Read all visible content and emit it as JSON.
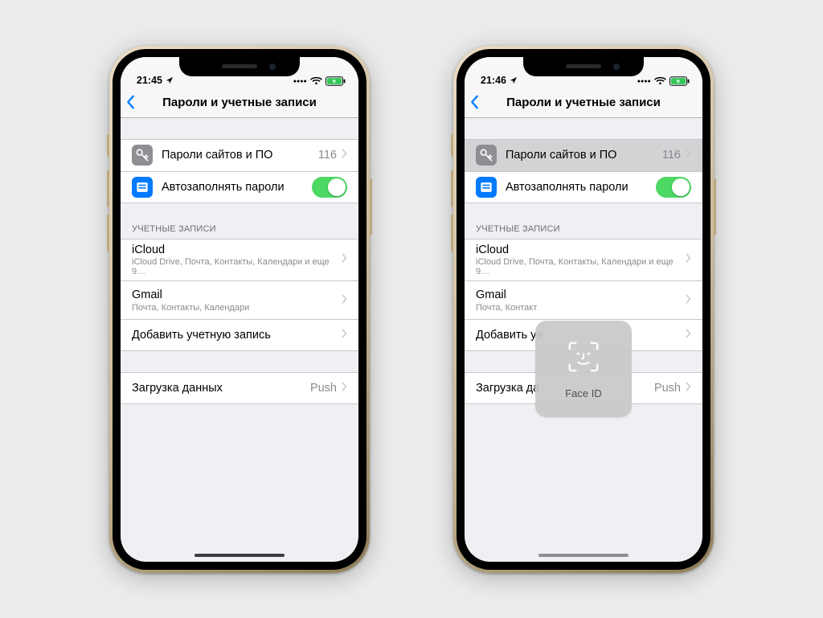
{
  "phone1": {
    "status_time": "21:45",
    "nav_title": "Пароли и учетные записи",
    "passwords_row_pressed": false
  },
  "phone2": {
    "status_time": "21:46",
    "nav_title": "Пароли и учетные записи",
    "passwords_row_pressed": true,
    "faceid_label": "Face ID"
  },
  "shared": {
    "passwords_label": "Пароли сайтов и ПО",
    "passwords_count": "116",
    "autofill_label": "Автозаполнять пароли",
    "accounts_header": "УЧЕТНЫЕ ЗАПИСИ",
    "account_icloud": {
      "title": "iCloud",
      "subtitle": "iCloud Drive, Почта, Контакты, Календари и еще 9…"
    },
    "account_gmail": {
      "title": "Gmail",
      "subtitle": "Почта, Контакты, Календари"
    },
    "account_gmail_short_subtitle": "Почта, Контакт",
    "add_account_label": "Добавить учетную запись",
    "add_account_label_short": "Добавить уч",
    "fetch_label": "Загрузка данных",
    "fetch_label_short": "Загрузка да",
    "fetch_value": "Push"
  }
}
